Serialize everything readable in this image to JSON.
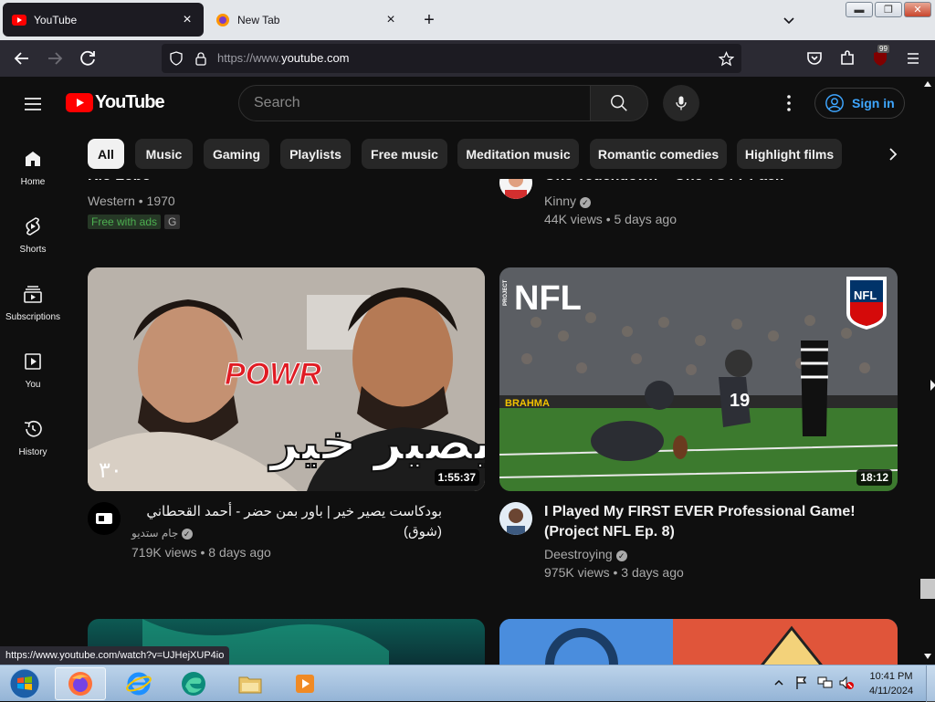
{
  "browser": {
    "tabs": [
      {
        "title": "YouTube",
        "active": true
      },
      {
        "title": "New Tab",
        "active": false
      }
    ],
    "new_tab_icon": "plus-icon",
    "url": {
      "prefix": "https://www.",
      "host": "youtube.com"
    },
    "extension_badge": "99",
    "status_url": "https://www.youtube.com/watch?v=UJHejXUP4io"
  },
  "youtube": {
    "logo_text": "YouTube",
    "search_placeholder": "Search",
    "sign_in": "Sign in",
    "chips": [
      "All",
      "Music",
      "Gaming",
      "Playlists",
      "Free music",
      "Meditation music",
      "Romantic comedies",
      "Highlight films"
    ],
    "sidebar": [
      {
        "label": "Home",
        "icon": "home-icon"
      },
      {
        "label": "Shorts",
        "icon": "shorts-icon"
      },
      {
        "label": "Subscriptions",
        "icon": "subscriptions-icon"
      },
      {
        "label": "You",
        "icon": "you-icon"
      },
      {
        "label": "History",
        "icon": "history-icon"
      }
    ],
    "top_row": {
      "left": {
        "title": "Rio Lobo",
        "meta": "Western • 1970",
        "badge": "Free with ads",
        "rating": "G"
      },
      "right": {
        "title": "One Touchdown = One TOTY Pack",
        "channel": "Kinny",
        "meta": "44K views • 5 days ago"
      }
    },
    "videos": [
      {
        "title": "بودكاست يصير خير | باور بمن حضر - أحمد القحطاني (شوق)",
        "channel": "جام ستديو",
        "meta": "719K views • 8 days ago",
        "duration": "1:55:37",
        "thumb_text_logo": "POWR",
        "thumb_text_arabic": "يصير خير",
        "thumb_text_num": "٣٠"
      },
      {
        "title_line1": "I Played My FIRST EVER Professional Game!",
        "title_line2": "(Project NFL Ep. 8)",
        "channel": "Deestroying",
        "meta": "975K views • 3 days ago",
        "duration": "18:12",
        "thumb_text_project": "PROJECT",
        "thumb_text_nfl": "NFL",
        "thumb_text_shield": "NFL",
        "thumb_text_jersey": "19",
        "thumb_text_banner": "BRAHMA"
      }
    ]
  },
  "taskbar": {
    "time": "10:41 PM",
    "date": "4/11/2024"
  }
}
